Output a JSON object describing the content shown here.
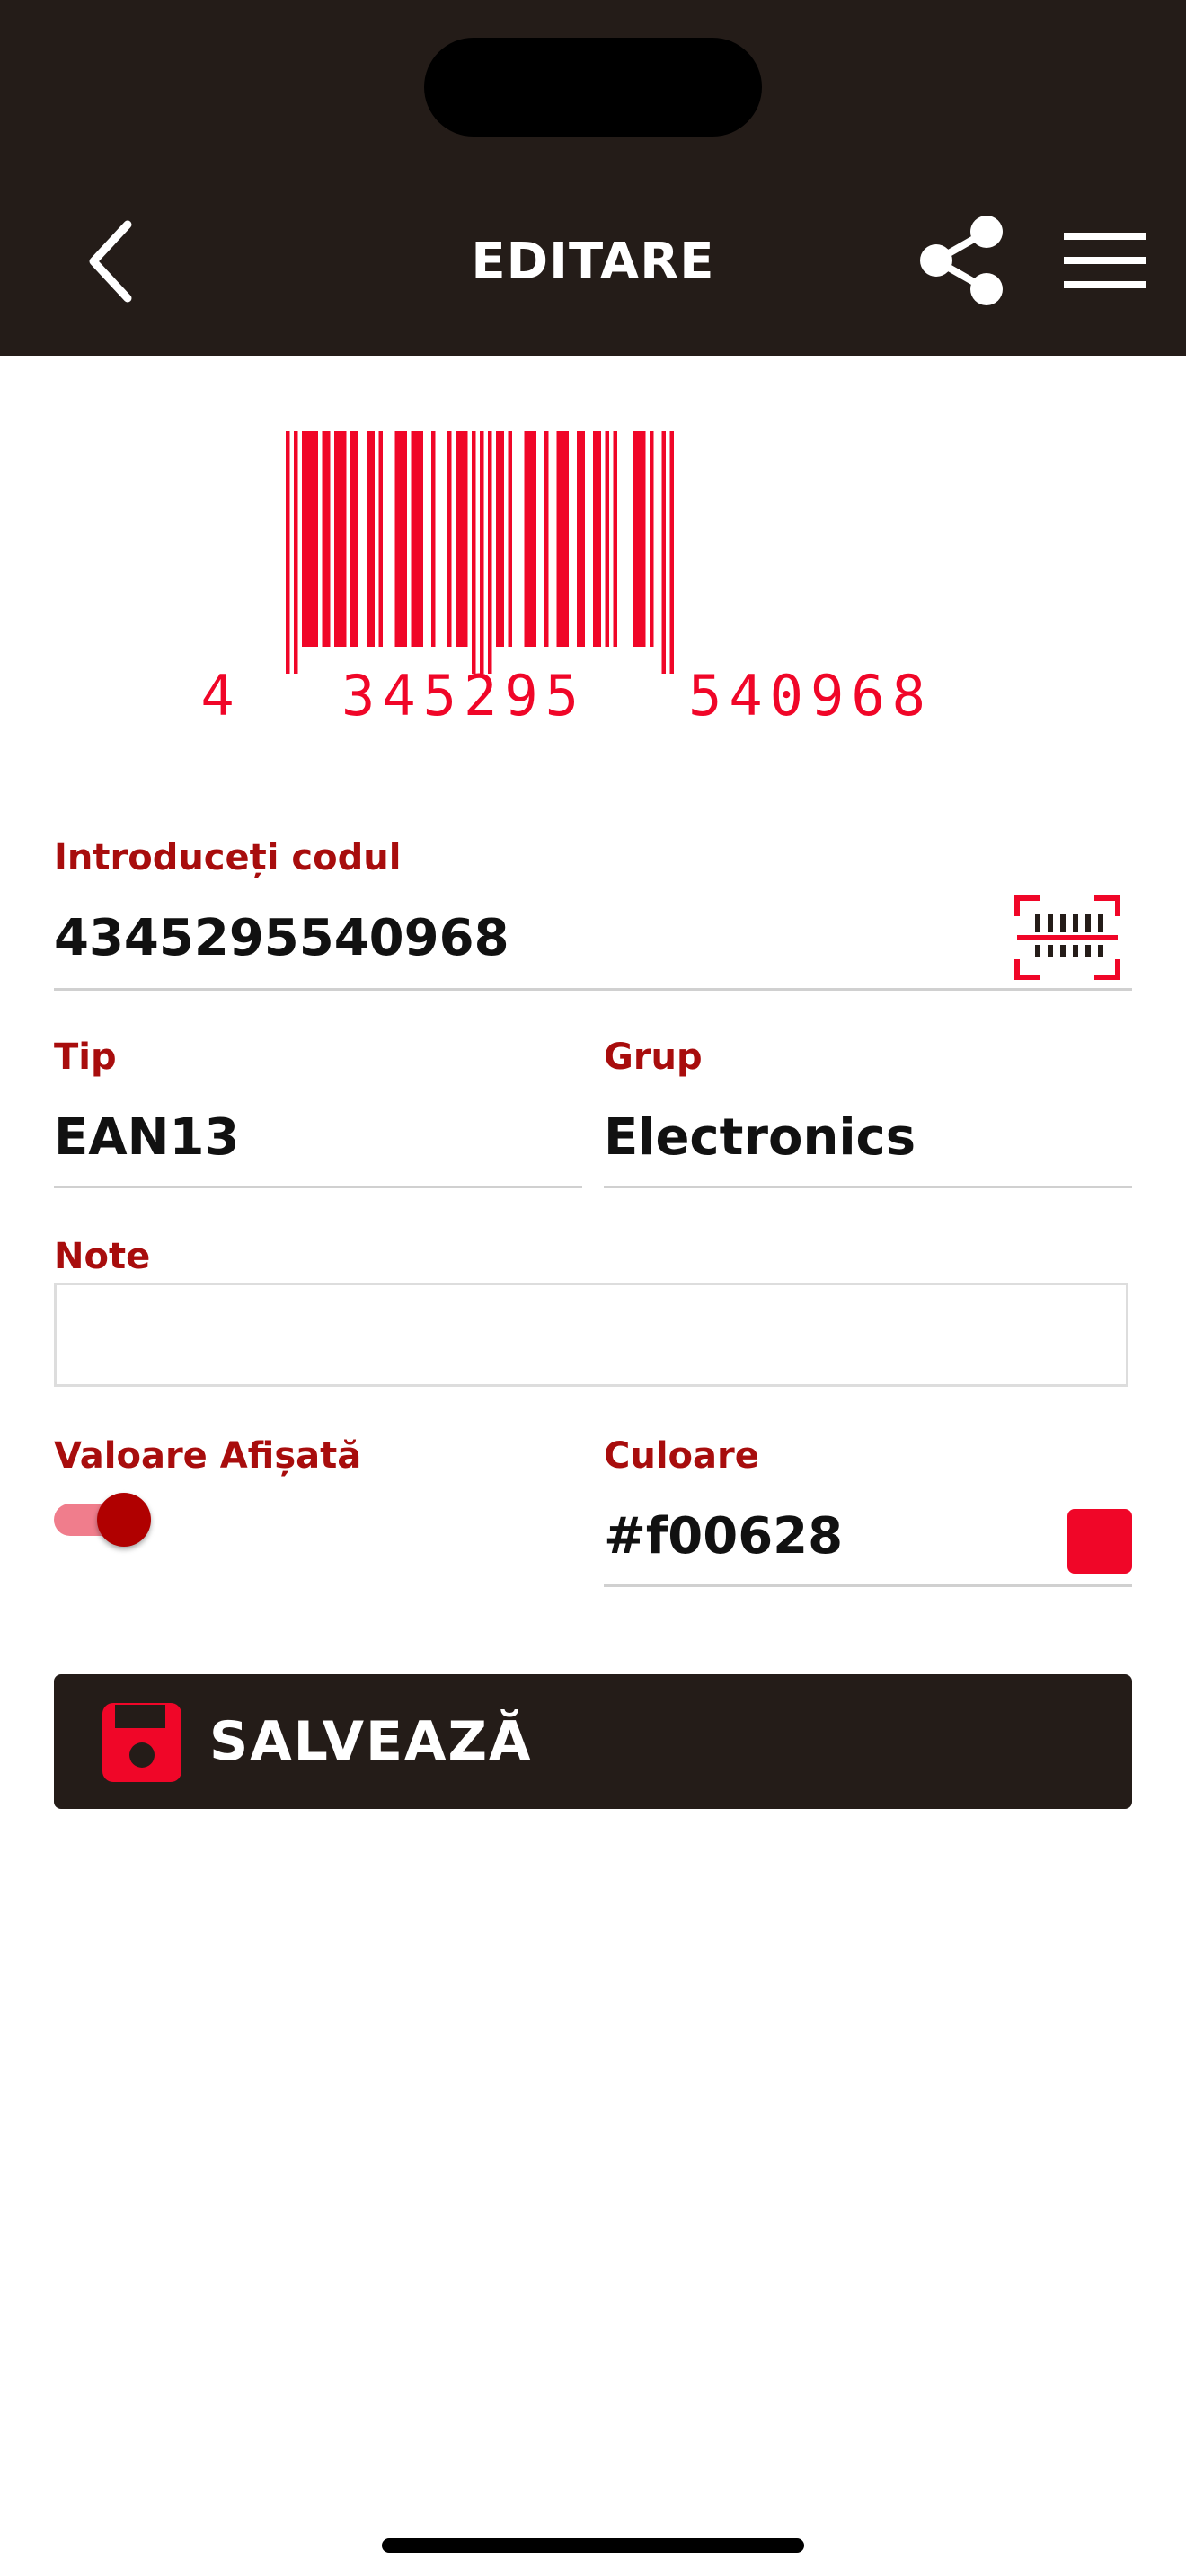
{
  "header": {
    "title": "EDITARE",
    "back_icon": "chevron-left-icon",
    "share_icon": "share-icon",
    "menu_icon": "hamburger-menu-icon"
  },
  "barcode": {
    "color": "#f00628",
    "digits_first": "4",
    "digits_left": "345295",
    "digits_right": "540968"
  },
  "form": {
    "code": {
      "label": "Introduceți codul",
      "value": "4345295540968",
      "scan_icon": "barcode-scan-icon"
    },
    "type": {
      "label": "Tip",
      "value": "EAN13"
    },
    "group": {
      "label": "Grup",
      "value": "Electronics"
    },
    "note": {
      "label": "Note",
      "value": ""
    },
    "show_value": {
      "label": "Valoare Afișată",
      "enabled": true
    },
    "color": {
      "label": "Culoare",
      "value": "#f00628",
      "swatch": "#f00628"
    }
  },
  "save_button": {
    "label": "SALVEAZĂ",
    "icon": "floppy-disk-icon"
  },
  "colors": {
    "header_bg": "#241c18",
    "label": "#a80d0d",
    "accent": "#f00628",
    "toggle_knob": "#b00000"
  }
}
